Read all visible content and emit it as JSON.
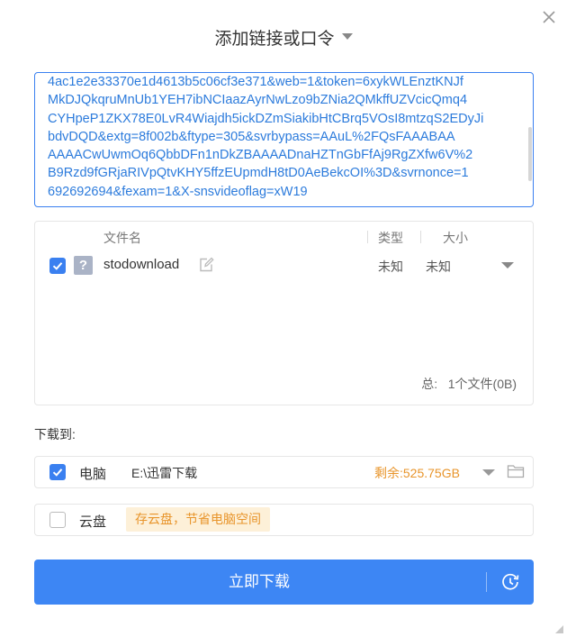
{
  "dialog": {
    "title": "添加链接或口令",
    "close_icon": "close-icon"
  },
  "url_input": {
    "lines": [
      "4ac1e2e33370e1d4613b5c06cf3e371&web=1&token=6xykWLEnztKNJf",
      "MkDJQkqruMnUb1YEH7ibNCIaazAyrNwLzo9bZNia2QMkffUZVcicQmq4",
      "CYHpeP1ZKX78E0LvR4Wiajdh5ickDZmSiakibHtCBrq5VOsI8mtzqS2EDyJi",
      "bdvDQD&extg=8f002b&ftype=305&svrbypass=AAuL%2FQsFAAABAA",
      "AAAACwUwmOq6QbbDFn1nDkZBAAAADnaHZTnGbFfAj9RgZXfw6V%2",
      "B9Rzd9fGRjaRIVpQtvKHY5ffzEUpmdH8tD0AeBekcOI%3D&svrnonce=1",
      "692692694&fexam=1&X-snsvideoflag=xW19"
    ]
  },
  "file_list": {
    "headers": {
      "name": "文件名",
      "type": "类型",
      "size": "大小"
    },
    "rows": [
      {
        "name": "stodownload",
        "type": "未知",
        "size": "未知",
        "checked": true,
        "icon": "unknown-file-icon"
      }
    ],
    "total_prefix": "总:",
    "total_value": "1个文件(0B)"
  },
  "download_to": {
    "label": "下载到:",
    "computer": {
      "label": "电脑",
      "path": "E:\\迅雷下载",
      "remaining": "剩余:525.75GB",
      "checked": true,
      "folder_icon": "folder-icon"
    },
    "cloud": {
      "label": "云盘",
      "tip": "存云盘，节省电脑空间",
      "checked": false
    }
  },
  "download_button": {
    "label": "立即下载",
    "icon": "clock-icon"
  },
  "colors": {
    "accent": "#3d86f4",
    "link_text": "#2c7bdc",
    "warning": "#e8942a",
    "tip_bg": "#fdf0d8"
  }
}
